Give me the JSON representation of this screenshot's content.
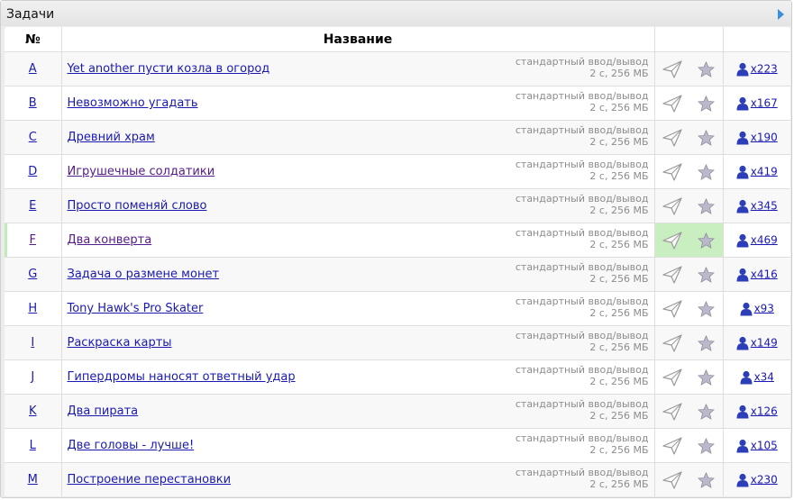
{
  "panel": {
    "title": "Задачи"
  },
  "table": {
    "headers": {
      "num": "№",
      "name": "Название"
    },
    "limits_line1": "стандартный ввод/вывод",
    "limits_line2": "2 с, 256 МБ",
    "rows": [
      {
        "id": "A",
        "name": "Yet another пусти козла в огород",
        "solved_count": "x223",
        "solved": false
      },
      {
        "id": "B",
        "name": "Невозможно угадать",
        "solved_count": "x167",
        "solved": false
      },
      {
        "id": "C",
        "name": "Древний храм",
        "solved_count": "x190",
        "solved": false
      },
      {
        "id": "D",
        "name": "Игрушечные солдатики",
        "solved_count": "x419",
        "solved": false
      },
      {
        "id": "E",
        "name": "Просто поменяй слово",
        "solved_count": "x345",
        "solved": false
      },
      {
        "id": "F",
        "name": "Два конверта",
        "solved_count": "x469",
        "solved": true
      },
      {
        "id": "G",
        "name": "Задача о размене монет",
        "solved_count": "x416",
        "solved": false
      },
      {
        "id": "H",
        "name": "Tony Hawk's Pro Skater",
        "solved_count": "x93",
        "solved": false
      },
      {
        "id": "I",
        "name": "Раскраска карты",
        "solved_count": "x149",
        "solved": false
      },
      {
        "id": "J",
        "name": "Гипердромы наносят ответный удар",
        "solved_count": "x34",
        "solved": false
      },
      {
        "id": "K",
        "name": "Два пирата",
        "solved_count": "x126",
        "solved": false
      },
      {
        "id": "L",
        "name": "Две головы - лучше!",
        "solved_count": "x105",
        "solved": false
      },
      {
        "id": "M",
        "name": "Построение перестановки",
        "solved_count": "x230",
        "solved": false
      }
    ]
  },
  "icons": {
    "submit": "paper-plane-icon",
    "favorite": "star-icon",
    "solvers": "user-icon",
    "panel_toggle": "triangle-right-icon"
  },
  "colors": {
    "link": "#1a1ab0",
    "visited_link": "#551a8b",
    "solved_highlight": "#c9eec0",
    "limits_text": "#8c8c8c"
  }
}
